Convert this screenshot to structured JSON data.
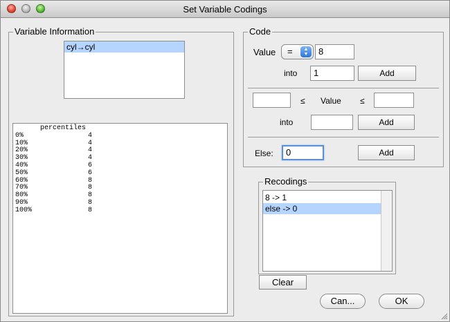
{
  "window": {
    "title": "Set Variable Codings"
  },
  "variable_info": {
    "legend": "Variable Information",
    "variables": [
      "cyl→cyl"
    ],
    "selected_index": 0,
    "summary_header": "      percentiles",
    "percentiles": [
      {
        "pct": "0%",
        "value": "4"
      },
      {
        "pct": "10%",
        "value": "4"
      },
      {
        "pct": "20%",
        "value": "4"
      },
      {
        "pct": "30%",
        "value": "4"
      },
      {
        "pct": "40%",
        "value": "6"
      },
      {
        "pct": "50%",
        "value": "6"
      },
      {
        "pct": "60%",
        "value": "8"
      },
      {
        "pct": "70%",
        "value": "8"
      },
      {
        "pct": "80%",
        "value": "8"
      },
      {
        "pct": "90%",
        "value": "8"
      },
      {
        "pct": "100%",
        "value": "8"
      }
    ]
  },
  "code": {
    "legend": "Code",
    "value_label": "Value",
    "operator": "=",
    "value": "8",
    "into_label": "into",
    "into_value": "1",
    "add_label": "Add",
    "range": {
      "lower": "",
      "le1": "≤",
      "value_label": "Value",
      "le2": "≤",
      "upper": "",
      "into_label": "into",
      "into_value": "",
      "add_label": "Add"
    },
    "else": {
      "label": "Else:",
      "value": "0",
      "add_label": "Add"
    }
  },
  "recodings": {
    "legend": "Recodings",
    "items": [
      "8 -> 1",
      "else -> 0"
    ],
    "selected_index": 1,
    "clear_label": "Clear"
  },
  "footer": {
    "cancel_label": "Can...",
    "ok_label": "OK"
  }
}
